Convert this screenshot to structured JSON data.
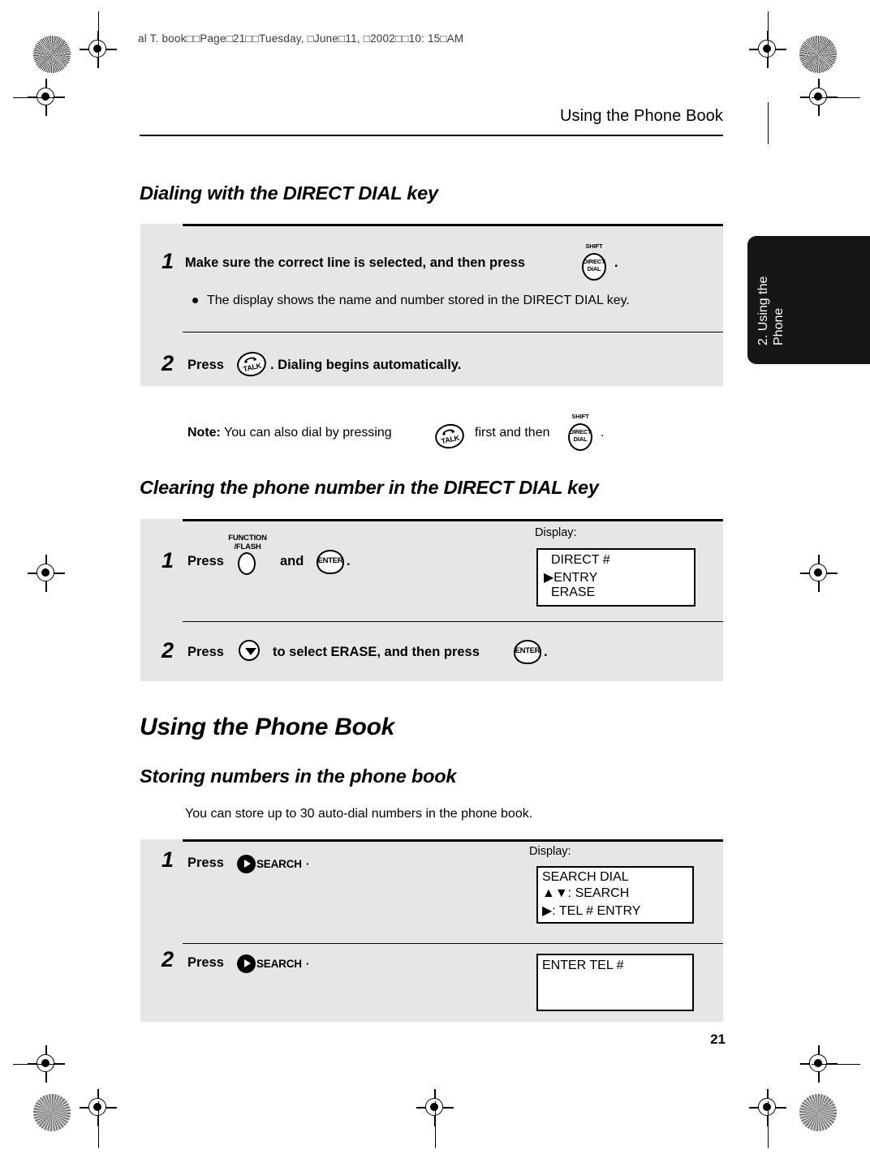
{
  "running_header": "al T. book□□Page□21□□Tuesday, □June□11, □2002□□10: 15□AM",
  "header": {
    "title": "Using the Phone Book",
    "page_number": "21"
  },
  "side_tab": {
    "label": "2. Using the\nPhone",
    "color": "#161616"
  },
  "sections": [
    {
      "heading": "Dialing with the DIRECT DIAL key",
      "steps": [
        {
          "number": "1",
          "text_before": "Make sure the correct line is selected, and then press",
          "key": "direct-dial-key",
          "text_after": ".",
          "bullet": "The display shows the name and number stored in the DIRECT DIAL key."
        },
        {
          "number": "2",
          "text_before": "Press",
          "key": "talk-key",
          "text_after": ". Dialing begins automatically."
        }
      ],
      "note": {
        "label": "Note:",
        "part1": "You can also dial by pressing",
        "part2": "first and then",
        "part3": "."
      }
    },
    {
      "heading": "Clearing the phone number in the DIRECT DIAL key",
      "steps": [
        {
          "number": "1",
          "text_before": "Press",
          "key_a": "function-flash-key",
          "text_middle": "and",
          "key_b": "enter-key",
          "text_after": "."
        },
        {
          "number": "2",
          "text_before": "Press",
          "key_a": "down-arrow-key",
          "text_middle": "to select ERASE, and then press",
          "key_b": "enter-key",
          "text_after": "."
        }
      ],
      "display": {
        "label": "Display:",
        "lines": [
          "DIRECT #",
          "▶ENTRY",
          "ERASE"
        ]
      }
    },
    {
      "heading": "Using the Phone Book",
      "subheading": "Storing numbers in the phone book",
      "intro": "You can store up to 30 auto-dial numbers in the phone book.",
      "steps": [
        {
          "number": "1",
          "text_before": "Press",
          "key": "search-key",
          "display_label": "Display:",
          "display_lines": [
            "SEARCH DIAL",
            "▲▼: SEARCH",
            "▶: TEL # ENTRY"
          ]
        },
        {
          "number": "2",
          "text_before": "Press",
          "key": "search-key",
          "display_lines": [
            "ENTER TEL #"
          ]
        }
      ]
    }
  ],
  "keys": {
    "direct_dial": {
      "shift_label": "SHIFT",
      "cap_line1": "DIRECT",
      "cap_line2": "DIAL"
    },
    "talk": {
      "cap": "TALK"
    },
    "function_flash": {
      "label_line1": "FUNCTION",
      "label_line2": "/FLASH"
    },
    "enter": {
      "cap": "ENTER"
    },
    "search": {
      "word": "SEARCH",
      "trailing": "·"
    }
  }
}
